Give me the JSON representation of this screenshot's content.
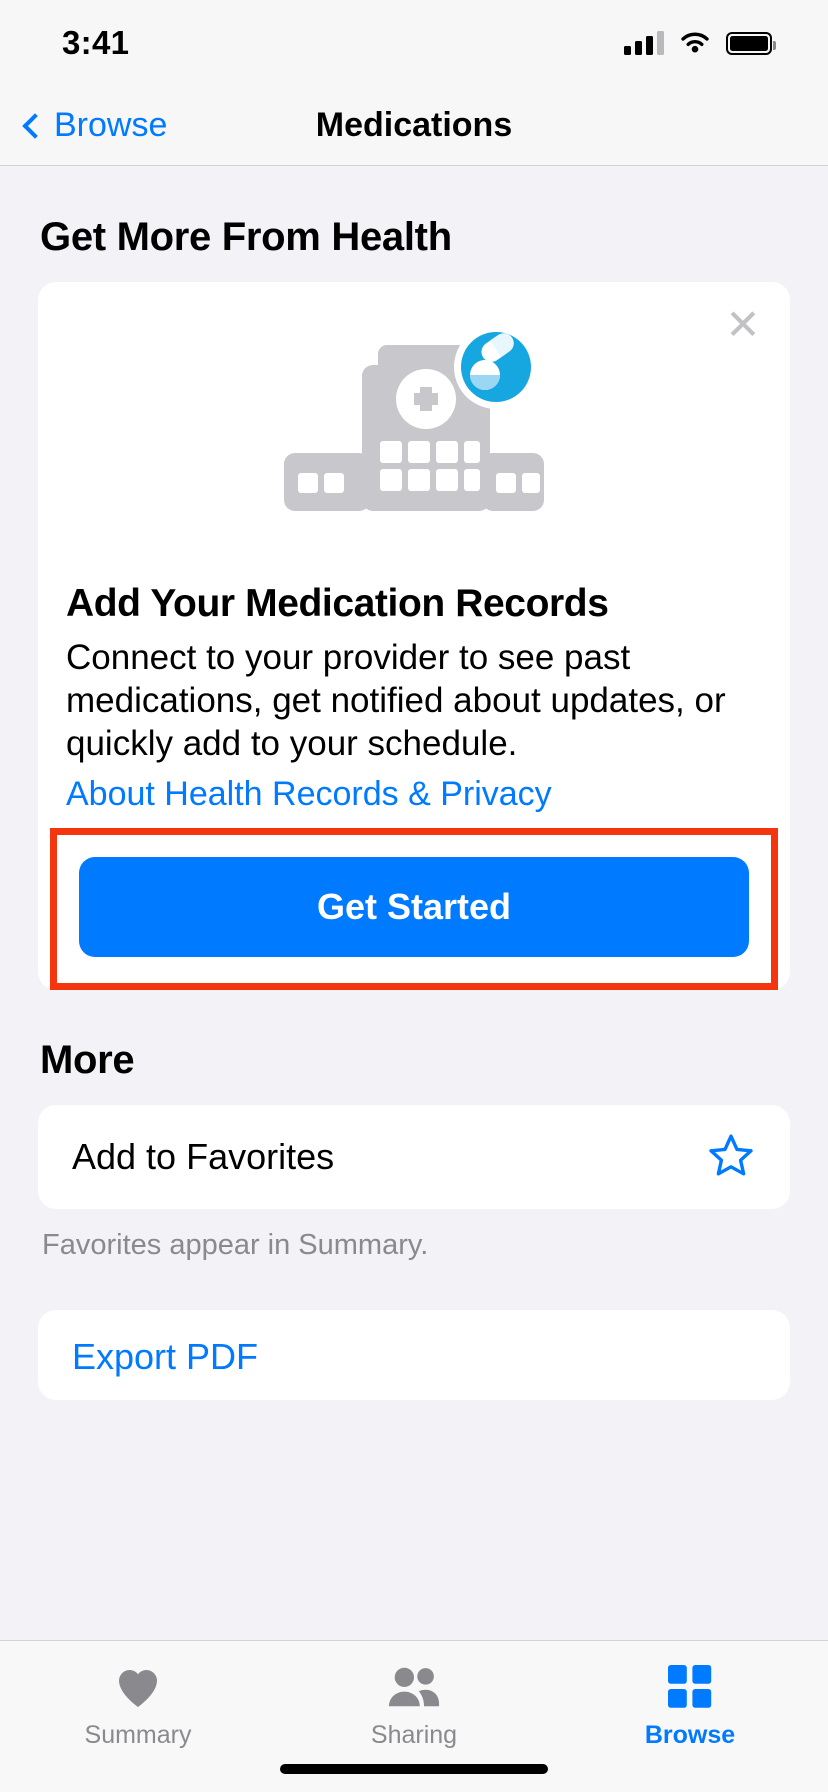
{
  "status_bar": {
    "time": "3:41",
    "cellular_icon": "cellular-bars-icon",
    "wifi_icon": "wifi-icon",
    "battery_icon": "battery-full-icon"
  },
  "nav": {
    "back_label": "Browse",
    "back_icon": "chevron-left-icon",
    "title": "Medications"
  },
  "promo_section": {
    "heading": "Get More From Health",
    "close_icon": "close-x-icon",
    "illustration": "hospital-with-pills-badge-illustration",
    "card_title": "Add Your Medication Records",
    "card_text": "Connect to your provider to see past medications, get notified about updates, or quickly add to your schedule.",
    "link_label": "About Health Records & Privacy",
    "cta_label": "Get Started",
    "highlight_color": "#f5350d",
    "cta_color": "#007aff"
  },
  "more_section": {
    "heading": "More",
    "favorites_label": "Add to Favorites",
    "favorites_icon": "star-outline-icon",
    "favorites_note": "Favorites appear in Summary.",
    "export_label": "Export PDF"
  },
  "tab_bar": {
    "tabs": [
      {
        "label": "Summary",
        "icon": "heart-icon",
        "active": false
      },
      {
        "label": "Sharing",
        "icon": "people-icon",
        "active": false
      },
      {
        "label": "Browse",
        "icon": "grid-icon",
        "active": true
      }
    ],
    "active_color": "#007aff",
    "inactive_color": "#8a8a8e"
  }
}
